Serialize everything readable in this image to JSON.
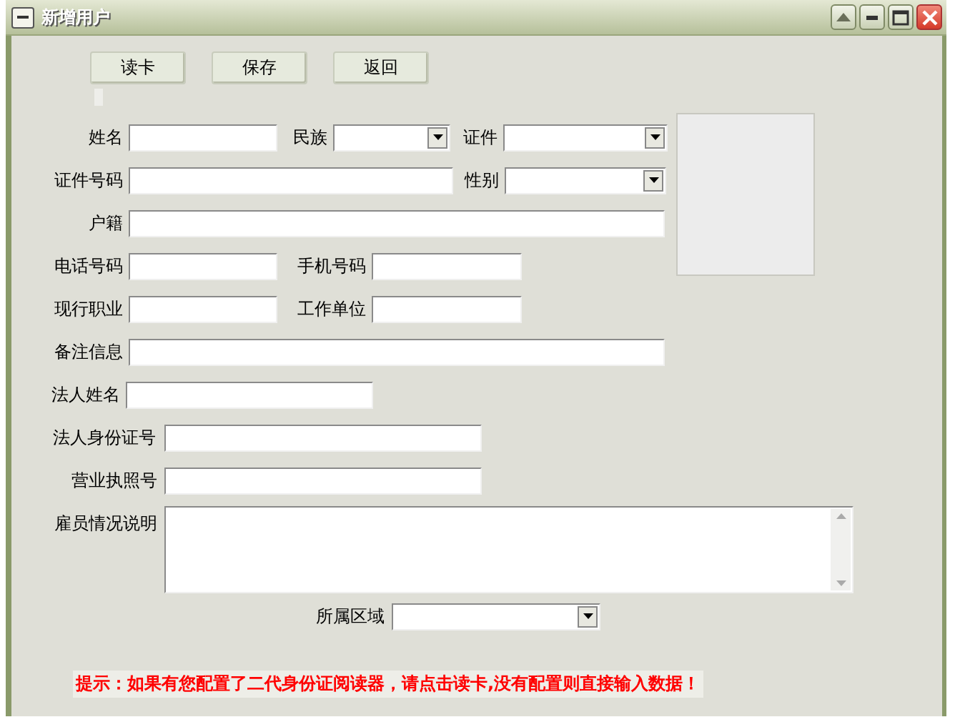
{
  "window": {
    "title": "新增用户"
  },
  "buttons": [
    {
      "label": "读卡"
    },
    {
      "label": "保存"
    },
    {
      "label": "返回"
    }
  ],
  "personal_rows": [
    {
      "fields": [
        {
          "label": "姓名",
          "kind": "text"
        },
        {
          "label": "民族",
          "kind": "select"
        },
        {
          "label": "证件",
          "kind": "select"
        }
      ]
    },
    {
      "fields": [
        {
          "label": "证件号码",
          "kind": "text"
        },
        {
          "label": "性别",
          "kind": "select"
        }
      ]
    },
    {
      "fields": [
        {
          "label": "户籍",
          "kind": "text"
        }
      ]
    },
    {
      "fields": [
        {
          "label": "电话号码",
          "kind": "text"
        },
        {
          "label": "手机号码",
          "kind": "text"
        }
      ]
    },
    {
      "fields": [
        {
          "label": "现行职业",
          "kind": "text"
        },
        {
          "label": "工作单位",
          "kind": "text"
        }
      ]
    }
  ],
  "other_rows": [
    {
      "fields": [
        {
          "label": "备注信息",
          "kind": "text"
        }
      ]
    },
    {
      "fields": [
        {
          "label": "法人姓名",
          "kind": "text"
        }
      ]
    },
    {
      "fields": [
        {
          "label": "法人身份证号",
          "kind": "text"
        }
      ]
    },
    {
      "fields": [
        {
          "label": "营业执照号",
          "kind": "text"
        }
      ]
    },
    {
      "fields": [
        {
          "label": "雇员情况说明",
          "kind": "textarea"
        }
      ]
    },
    {
      "fields": [
        {
          "label": "所属区域",
          "kind": "select"
        }
      ]
    }
  ],
  "tip": "提示：如果有您配置了二代身份证阅读器，请点击读卡,没有配置则直接输入数据！"
}
